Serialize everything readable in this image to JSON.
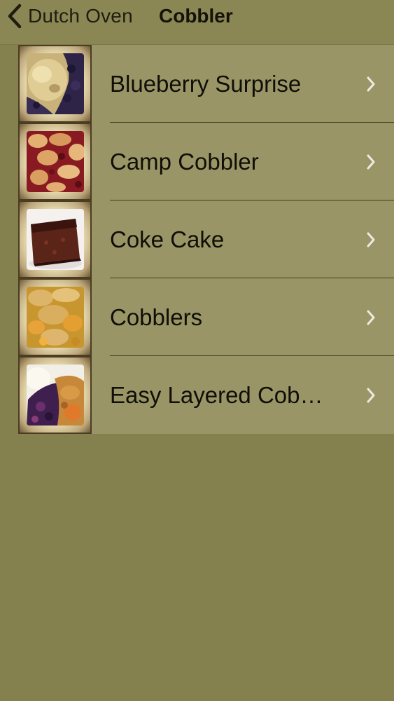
{
  "navbar": {
    "back_label": "Dutch Oven",
    "title": "Cobbler"
  },
  "recipes": [
    {
      "label": "Blueberry Surprise",
      "photo": "blueberry-cobbler-photo"
    },
    {
      "label": "Camp Cobbler",
      "photo": "cherry-cobbler-photo"
    },
    {
      "label": "Coke Cake",
      "photo": "chocolate-cake-photo"
    },
    {
      "label": "Cobblers",
      "photo": "peach-cobbler-photo"
    },
    {
      "label": "Easy Layered Cob…",
      "photo": "layered-cobbler-photo"
    }
  ],
  "icons": {
    "back": "chevron-left-icon",
    "disclosure": "chevron-right-icon"
  },
  "colors": {
    "navbar_bg": "#8b8755",
    "list_bg": "#9a9566",
    "page_bg": "#85814f",
    "chevron": "#ecebe2"
  }
}
